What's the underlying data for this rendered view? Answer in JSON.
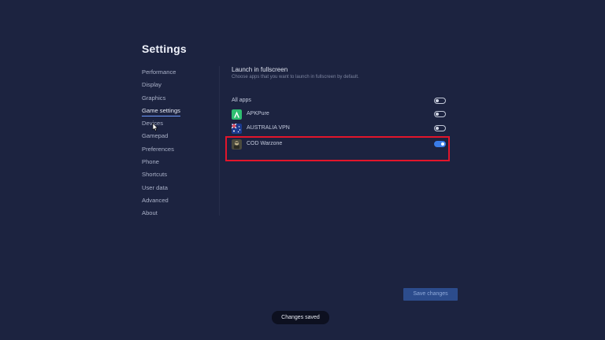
{
  "page_title": "Settings",
  "sidebar": {
    "items": [
      {
        "label": "Performance"
      },
      {
        "label": "Display"
      },
      {
        "label": "Graphics"
      },
      {
        "label": "Game settings",
        "active": true
      },
      {
        "label": "Devices"
      },
      {
        "label": "Gamepad"
      },
      {
        "label": "Preferences"
      },
      {
        "label": "Phone"
      },
      {
        "label": "Shortcuts"
      },
      {
        "label": "User data"
      },
      {
        "label": "Advanced"
      },
      {
        "label": "About"
      }
    ]
  },
  "section": {
    "title": "Launch in fullscreen",
    "description": "Choose apps that you want to launch in fullscreen by default."
  },
  "apps": [
    {
      "name": "All apps",
      "icon": null,
      "enabled": false
    },
    {
      "name": "APKPure",
      "icon": "apkpure-icon",
      "enabled": false
    },
    {
      "name": "AUSTRALIA VPN",
      "icon": "australia-flag-icon",
      "enabled": false
    },
    {
      "name": "COD Warzone",
      "icon": "cod-warzone-icon",
      "enabled": true
    }
  ],
  "save_button": {
    "label": "Save changes"
  },
  "toast": {
    "message": "Changes saved"
  },
  "colors": {
    "background": "#1c2340",
    "accent": "#3a7ce8",
    "highlight": "#e2152b",
    "apkpure_green": "#2fbf71"
  }
}
